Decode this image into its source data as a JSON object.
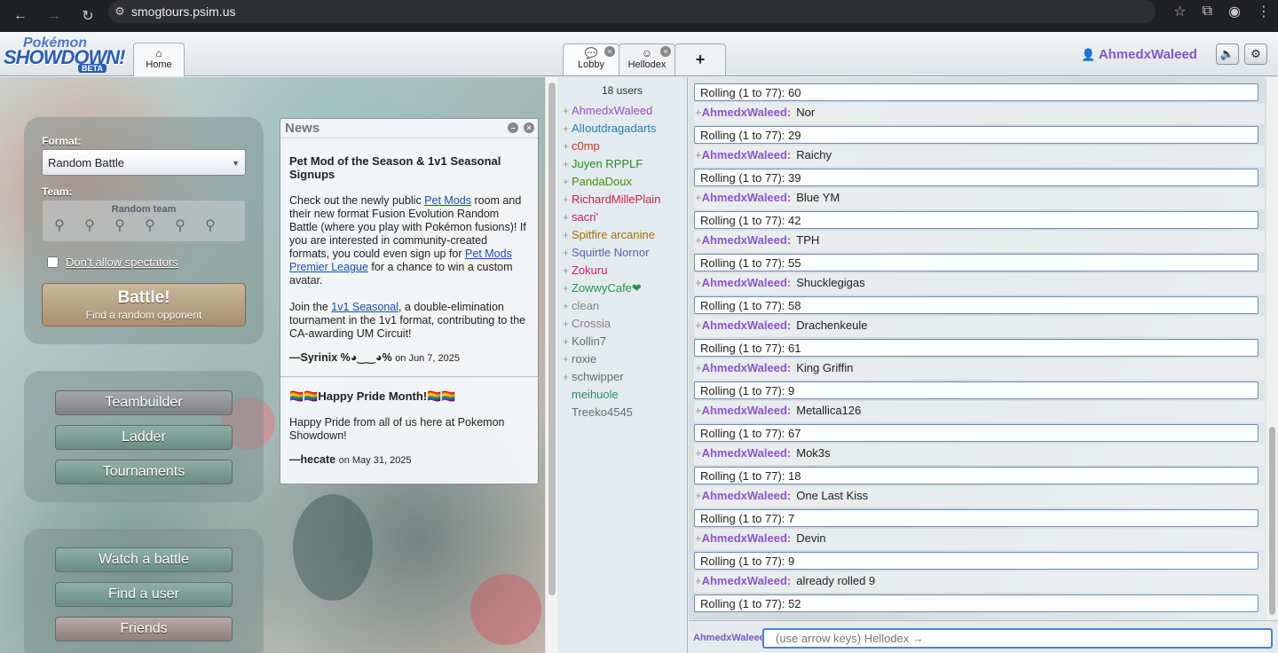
{
  "browser": {
    "url": "smogtours.psim.us"
  },
  "header": {
    "logo_top": "Pokémon",
    "logo_main": "SHOWDOWN!",
    "logo_badge": "BETA",
    "home_tab": "Home",
    "tabs": [
      {
        "label": "Lobby"
      },
      {
        "label": "Hellodex"
      }
    ],
    "add_tab": "+",
    "username": "AhmedxWaleed"
  },
  "battle_form": {
    "format_label": "Format:",
    "format_value": "Random Battle",
    "team_label": "Team:",
    "team_value": "Random team",
    "spectators_label": "Don't allow spectators",
    "battle_label": "Battle!",
    "battle_sublabel": "Find a random opponent"
  },
  "menu": {
    "teambuilder": "Teambuilder",
    "ladder": "Ladder",
    "tournaments": "Tournaments",
    "watch": "Watch a battle",
    "find_user": "Find a user",
    "friends": "Friends"
  },
  "news": {
    "title": "News",
    "post1": {
      "headline": "Pet Mod of the Season & 1v1 Seasonal Signups",
      "p1_a": "Check out the newly public ",
      "p1_link": "Pet Mods",
      "p1_b": " room and their new format Fusion Evolution Random Battle (where you play with Pokémon fusions)! If you are interested in community-created formats, you could even sign up for ",
      "p1_link2": "Pet Mods Premier League",
      "p1_c": " for a chance to win a custom avatar.",
      "p2_a": "Join the ",
      "p2_link": "1v1 Seasonal",
      "p2_b": ", a double-elimination tournament in the 1v1 format, contributing to the CA-awarding UM Circuit!",
      "author": "—Syrinix %◕‿‿◕%",
      "date": "on Jun 7, 2025"
    },
    "post2": {
      "headline": "🏳️‍🌈🏳️‍🌈Happy Pride Month!🏳️‍🌈🏳️‍🌈",
      "body": "Happy Pride from all of us here at Pokemon Showdown!",
      "author": "—hecate",
      "date": "on May 31, 2025"
    }
  },
  "userlist": {
    "count": "18 users",
    "users": [
      {
        "rank": "+",
        "name": "AhmedxWaleed",
        "color": "#9a4fc4"
      },
      {
        "rank": "+",
        "name": "AlIoutdragadarts",
        "color": "#1f7fb0"
      },
      {
        "rank": "+",
        "name": "c0mp",
        "color": "#c0392b"
      },
      {
        "rank": "+",
        "name": "Juyen RPPLF",
        "color": "#2b8a2b"
      },
      {
        "rank": "+",
        "name": "PandaDoux",
        "color": "#4a8a1a"
      },
      {
        "rank": "+",
        "name": "RichardMillePlain",
        "color": "#c0224f"
      },
      {
        "rank": "+",
        "name": "sacri'",
        "color": "#c0226a"
      },
      {
        "rank": "+",
        "name": "Spitfire arcanine",
        "color": "#a0700f"
      },
      {
        "rank": "+",
        "name": "Squirtle Nornor",
        "color": "#5a5fb0"
      },
      {
        "rank": "+",
        "name": "Zokuru",
        "color": "#c0226a"
      },
      {
        "rank": "+",
        "name": "ZowwyCafe❤",
        "color": "#1f9a4f"
      },
      {
        "rank": "+",
        "name": "clean",
        "color": "#7b8a8a"
      },
      {
        "rank": "+",
        "name": "Crossia",
        "color": "#8a7a7a"
      },
      {
        "rank": "+",
        "name": "Kollin7",
        "color": "#6a6a6a"
      },
      {
        "rank": "+",
        "name": "roxie",
        "color": "#6a6a6a"
      },
      {
        "rank": "+",
        "name": "schwipper",
        "color": "#6a6a6a"
      },
      {
        "rank": "",
        "name": "meihuole",
        "color": "#2b8a6a"
      },
      {
        "rank": "",
        "name": "Treeko4545",
        "color": "#6a6a6a"
      }
    ]
  },
  "chat": {
    "roll_prefix": "Rolling (1 to 77): ",
    "rank": "+",
    "user": "AhmedxWaleed:",
    "top_roll": "60",
    "entries": [
      {
        "text": "Nor",
        "roll": "29"
      },
      {
        "text": "Raichy",
        "roll": "39"
      },
      {
        "text": "Blue YM",
        "roll": "42"
      },
      {
        "text": "TPH",
        "roll": "55"
      },
      {
        "text": "Shucklegigas",
        "roll": "58"
      },
      {
        "text": "Drachenkeule",
        "roll": "61"
      },
      {
        "text": "King Griffin",
        "roll": "9"
      },
      {
        "text": "Metallica126",
        "roll": "67"
      },
      {
        "text": "Mok3s",
        "roll": "18"
      },
      {
        "text": "One Last Kiss",
        "roll": "7"
      },
      {
        "text": "Devin",
        "roll": "9"
      },
      {
        "text": "already rolled 9",
        "roll": "52"
      }
    ],
    "input_user": "AhmedxWaleed",
    "input_placeholder": "(use arrow keys) Hellodex →"
  }
}
